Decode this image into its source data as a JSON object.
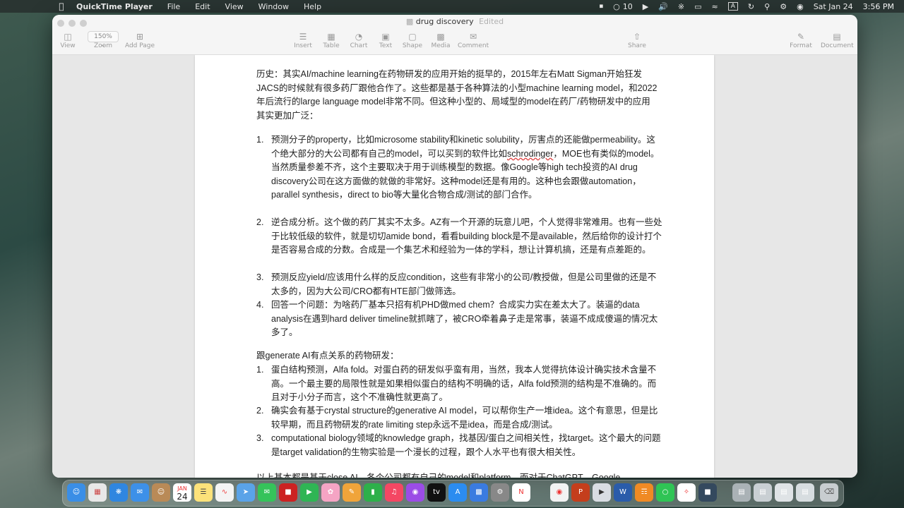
{
  "menubar": {
    "app": "QuickTime Player",
    "menus": [
      "File",
      "Edit",
      "View",
      "Window",
      "Help"
    ],
    "wechat_count": "10",
    "input_source": "A",
    "date": "Sat Jan 24",
    "time": "3:56 PM"
  },
  "window": {
    "title": "drug discovery",
    "status": "Edited",
    "zoom": "150%",
    "toolbar": {
      "view": "View",
      "zoom": "Zoom",
      "add_page": "Add Page",
      "insert": "Insert",
      "table": "Table",
      "chart": "Chart",
      "text": "Text",
      "shape": "Shape",
      "media": "Media",
      "comment": "Comment",
      "share": "Share",
      "format": "Format",
      "document": "Document"
    }
  },
  "doc": {
    "p1": "历史：其实AI/machine learning在药物研发的应用开始的挺早的，2015年左右Matt Sigman开始狂发JACS的时候就有很多药厂跟他合作了。这些都是基于各种算法的小型machine learning model，和2022年后流行的large language model非常不同。但这种小型的、局域型的model在药厂/药物研发中的应用其实更加广泛：",
    "list1": [
      {
        "num": "1.",
        "pre": "预测分子的property，比如microsome stability和kinetic solubility，厉害点的还能做permeability。这个绝大部分的大公司都有自己的model，可以买到的软件比如",
        "squig": "schrodinger",
        "post": "，MOE也有类似的model。当然质量参差不齐，这个主要取决于用于训练模型的数据。像Google等high tech投资的AI drug discovery公司在这方面做的就做的非常好。这种model还是有用的。这种也会跟做automation，parallel synthesis，direct to bio等大量化合物合成/测试的部门合作。"
      },
      {
        "num": "2.",
        "pre": "逆合成分析。这个做的药厂其实不太多。AZ有一个开源的玩意儿吧，个人觉得非常难用。也有一些处于比较低级的软件，就是切切amide bond，看看building block是不是available，然后给你的设计打个是否容易合成的分数。合成是一个集艺术和经验为一体的学科，想让计算机搞，还是有点差距的。",
        "squig": "",
        "post": ""
      },
      {
        "num": "3.",
        "pre": "预测反应yield/应该用什么样的反应condition，这些有非常小的公司/教授做，但是公司里做的还是不太多的，因为大公司/CRO都有HTE部门做筛选。",
        "squig": "",
        "post": ""
      },
      {
        "num": "4.",
        "pre": "回答一个问题：为啥药厂基本只招有机PHD做med chem？合成实力实在差太大了。装逼的data analysis在遇到hard deliver timeline就抓瞎了，被CRO牵着鼻子走是常事，装逼不成成傻逼的情况太多了。",
        "squig": "",
        "post": ""
      }
    ],
    "p2": "跟generate AI有点关系的药物研发：",
    "list2": [
      {
        "num": "1.",
        "text": "蛋白结构预测，Alfa fold。对蛋白药的研发似乎蛮有用，当然，我本人觉得抗体设计确实技术含量不高。一个最主要的局限性就是如果相似蛋白的结构不明确的话，Alfa fold预测的结构是不准确的。而且对于小分子而言，这个不准确性就更高了。"
      },
      {
        "num": "2.",
        "text": "确实会有基于crystal structure的generative AI model，可以帮你生产一堆idea。这个有意思，但是比较早期，而且药物研发的rate limiting step永远不是idea，而是合成/测试。"
      },
      {
        "num": "3.",
        "text": "computational biology领域的knowledge graph，找基因/蛋白之间相关性，找target。这个最大的问题是target validation的生物实验是一个漫长的过程，跟个人水平也有很大相关性。"
      }
    ],
    "p3": "以上基本都是基于close AI，各个公司都有自己的model和platform。而对于ChatGPT，Google"
  },
  "dock": {
    "calendar_month": "JAN",
    "calendar_day": "24"
  }
}
